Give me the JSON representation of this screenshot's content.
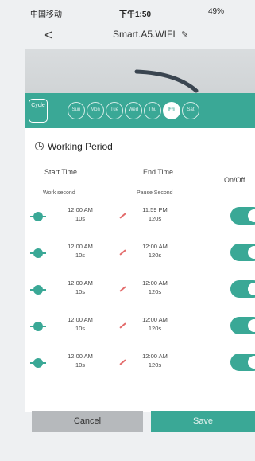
{
  "status_bar": {
    "carrier": "中国移动",
    "time": "下午1:50",
    "battery": "49%"
  },
  "header": {
    "back_symbol": "<",
    "title": "Smart.A5.WIFI",
    "edit_icon": "pencil-icon"
  },
  "cycle": {
    "label": "Cycle",
    "days": [
      "Sun",
      "Mon",
      "Tue",
      "Wed",
      "Thu",
      "Fri",
      "Sat"
    ],
    "selected_day": "Fri"
  },
  "working_period": {
    "title": "Working Period",
    "columns": {
      "start": "Start Time",
      "end": "End Time",
      "onoff": "On/Off"
    },
    "subcolumns": {
      "start": "Work second",
      "end": "Pause Second"
    },
    "rows": [
      {
        "start_time": "12:00 AM",
        "work_second": "10s",
        "end_time": "11:59 PM",
        "pause_second": "120s",
        "on": true
      },
      {
        "start_time": "12:00 AM",
        "work_second": "10s",
        "end_time": "12:00 AM",
        "pause_second": "120s",
        "on": true
      },
      {
        "start_time": "12:00 AM",
        "work_second": "10s",
        "end_time": "12:00 AM",
        "pause_second": "120s",
        "on": true
      },
      {
        "start_time": "12:00 AM",
        "work_second": "10s",
        "end_time": "12:00 AM",
        "pause_second": "120s",
        "on": true
      },
      {
        "start_time": "12:00 AM",
        "work_second": "10s",
        "end_time": "12:00 AM",
        "pause_second": "120s",
        "on": true
      }
    ]
  },
  "actions": {
    "cancel": "Cancel",
    "save": "Save"
  },
  "colors": {
    "accent": "#3aa896",
    "cancel_bg": "#b6b9bc"
  }
}
